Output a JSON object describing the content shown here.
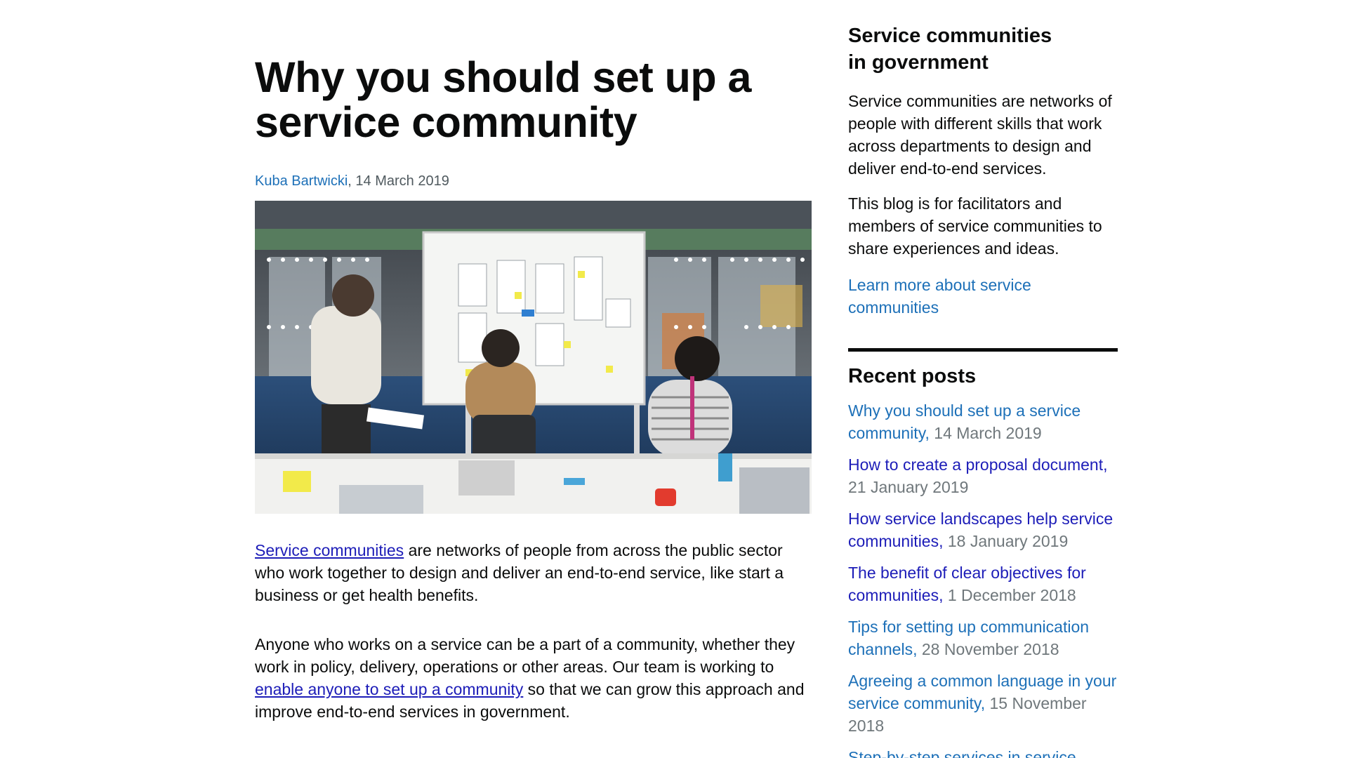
{
  "article": {
    "title": "Why you should set up a service community",
    "author": "Kuba Bartwicki",
    "date_sep": ", ",
    "date": "14 March 2019",
    "hero_image": "photo-of-team-working-at-whiteboard",
    "para1": {
      "link": "Service communities",
      "text": " are networks of people from across the public sector who work together to design and deliver an end-to-end service, like start a business or get health benefits."
    },
    "para2": {
      "text_before": "Anyone who works on a service can be a part of a community, whether they work in policy, delivery, operations or other areas. Our team is working to ",
      "link": "enable anyone to set up a community",
      "text_after": " so that we can grow this approach and improve end-to-end services in government."
    }
  },
  "sidebar": {
    "title": "Service communities in government",
    "text1": "Service communities are networks of people with different skills that work across departments to design and deliver end-to-end services.",
    "text2": "This blog is for facilitators and members of service communities to share experiences and ideas.",
    "learn_more": "Learn more about service communities",
    "recent_title": "Recent posts",
    "recent_posts": [
      {
        "title": "Why you should set up a service community,",
        "date": " 14 March 2019"
      },
      {
        "title": "How to create a proposal document,",
        "date": " 21 January 2019"
      },
      {
        "title": "How service landscapes help service communities,",
        "date": " 18 January 2019"
      },
      {
        "title": "The benefit of clear objectives for communities,",
        "date": " 1 December 2018"
      },
      {
        "title": "Tips for setting up communication channels,",
        "date": " 28 November 2018"
      },
      {
        "title": "Agreeing a common language in your service community,",
        "date": " 15 November 2018"
      },
      {
        "title": "Step-by-step services in service",
        "date": ""
      }
    ]
  },
  "colors": {
    "text": "#0b0c0c",
    "link": "#1d70b8",
    "visited_link": "#1d1db8",
    "secondary_text": "#505a5f"
  }
}
